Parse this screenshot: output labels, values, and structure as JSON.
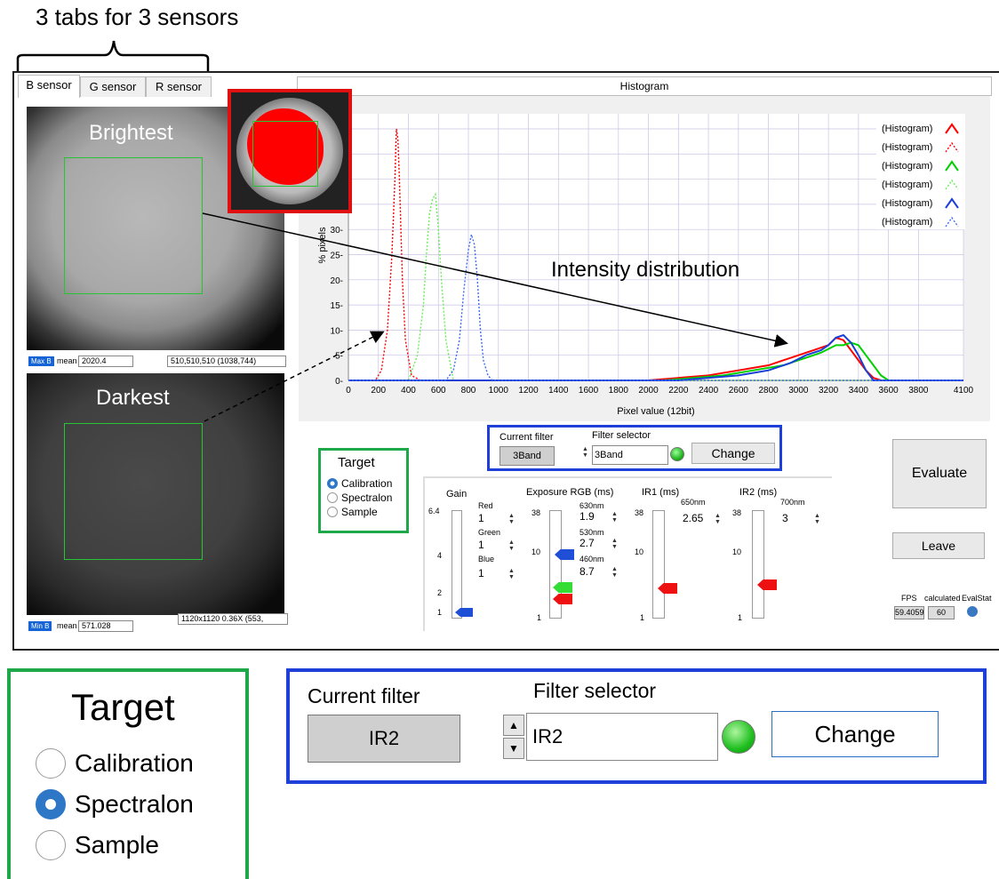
{
  "annotation": {
    "title": "3 tabs for 3 sensors",
    "intensity_label": "Intensity distribution"
  },
  "tabs": [
    {
      "label": "B sensor",
      "active": true
    },
    {
      "label": "G sensor",
      "active": false
    },
    {
      "label": "R sensor",
      "active": false
    }
  ],
  "brightest": {
    "label": "Brightest",
    "badge": "Max B",
    "mean_label": "mean",
    "mean_value": "2020.4",
    "info": "510,510,510   (1038,744)"
  },
  "darkest": {
    "label": "Darkest",
    "badge": "Min B",
    "mean_label": "mean",
    "mean_value": "571.028",
    "info": "1120x1120 0.36X    (553,"
  },
  "histogram": {
    "title": "Histogram"
  },
  "chart_data": {
    "type": "line",
    "xlabel": "Pixel value (12bit)",
    "ylabel": "% pixels",
    "xlim": [
      0,
      4100
    ],
    "ylim": [
      0,
      30
    ],
    "xticks": [
      "0",
      "200",
      "400",
      "600",
      "800",
      "1000",
      "1200",
      "1400",
      "1600",
      "1800",
      "2000",
      "2200",
      "2400",
      "2600",
      "2800",
      "3000",
      "3200",
      "3400",
      "3600",
      "3800",
      "4100"
    ],
    "yticks": [
      "0",
      "5",
      "10",
      "15",
      "20",
      "25",
      "30"
    ],
    "grid": true,
    "legend": "top-right",
    "series": [
      {
        "name": "(Histogram)",
        "color": "#ff0000",
        "style": "solid",
        "x": [
          0,
          2000,
          2400,
          2600,
          2800,
          2900,
          3000,
          3100,
          3150,
          3200,
          3250,
          3300,
          3350,
          3400,
          3450,
          3500,
          3550,
          4100
        ],
        "y": [
          0,
          0,
          1,
          2,
          3,
          4,
          5,
          6,
          6.5,
          7,
          8.5,
          8,
          6,
          4,
          2,
          0.5,
          0,
          0
        ]
      },
      {
        "name": "(Histogram)",
        "color": "#ff0000",
        "style": "dotted",
        "x": [
          0,
          180,
          220,
          260,
          290,
          310,
          320,
          330,
          340,
          350,
          360,
          380,
          420,
          480,
          4100
        ],
        "y": [
          0,
          0,
          2,
          10,
          25,
          40,
          50,
          48,
          40,
          30,
          20,
          8,
          1,
          0,
          0
        ]
      },
      {
        "name": "(Histogram)",
        "color": "#00d000",
        "style": "solid",
        "x": [
          0,
          2100,
          2500,
          2700,
          2900,
          3050,
          3150,
          3250,
          3300,
          3350,
          3400,
          3450,
          3500,
          3550,
          3600,
          4100
        ],
        "y": [
          0,
          0,
          1,
          2,
          3,
          4.5,
          5.5,
          7,
          7,
          7.5,
          7,
          5,
          3,
          1,
          0,
          0
        ]
      },
      {
        "name": "(Histogram)",
        "color": "#66ee55",
        "style": "dotted",
        "x": [
          0,
          400,
          460,
          500,
          520,
          540,
          560,
          580,
          600,
          620,
          650,
          700,
          4100
        ],
        "y": [
          0,
          0,
          5,
          15,
          25,
          33,
          36,
          37,
          30,
          20,
          8,
          0,
          0
        ]
      },
      {
        "name": "(Histogram)",
        "color": "#1a3fd6",
        "style": "solid",
        "x": [
          0,
          2200,
          2600,
          2800,
          2950,
          3050,
          3150,
          3200,
          3250,
          3300,
          3350,
          3400,
          3450,
          3500,
          4100
        ],
        "y": [
          0,
          0,
          1,
          2,
          3.5,
          5,
          6,
          7,
          8.5,
          9,
          7.5,
          5,
          2,
          0,
          0
        ]
      },
      {
        "name": "(Histogram)",
        "color": "#3b6df0",
        "style": "dotted",
        "x": [
          0,
          650,
          700,
          740,
          770,
          800,
          820,
          840,
          860,
          880,
          900,
          930,
          960,
          4100
        ],
        "y": [
          0,
          0,
          2,
          8,
          18,
          26,
          29,
          27,
          20,
          10,
          4,
          1,
          0,
          0
        ]
      }
    ]
  },
  "target_panel": {
    "title": "Target",
    "options": [
      {
        "label": "Calibration",
        "selected": true
      },
      {
        "label": "Spectralon",
        "selected": false
      },
      {
        "label": "Sample",
        "selected": false
      }
    ]
  },
  "filter_panel": {
    "current_filter_label": "Current filter",
    "current_filter_value": "3Band",
    "selector_label": "Filter selector",
    "selector_value": "3Band",
    "change_button": "Change"
  },
  "evaluate_button": "Evaluate",
  "leave_button": "Leave",
  "gain": {
    "label": "Gain",
    "top_tick": "6.4",
    "ticks": [
      "4",
      "2",
      "1"
    ],
    "red_label": "Red",
    "red_value": "1",
    "green_label": "Green",
    "green_value": "1",
    "blue_label": "Blue",
    "blue_value": "1"
  },
  "exposure": {
    "label": "Exposure RGB (ms)",
    "top_tick": "38",
    "mid_tick": "10",
    "low_tick": "1",
    "nm630": "630nm",
    "v630": "1.9",
    "nm530": "530nm",
    "v530": "2.7",
    "nm460": "460nm",
    "v460": "8.7"
  },
  "ir1": {
    "label": "IR1 (ms)",
    "nm": "650nm",
    "value": "2.65",
    "top_tick": "38",
    "mid_tick": "10",
    "low_tick": "1"
  },
  "ir2": {
    "label": "IR2 (ms)",
    "nm": "700nm",
    "value": "3",
    "top_tick": "38",
    "mid_tick": "10",
    "low_tick": "1"
  },
  "stats": {
    "fps_label": "FPS",
    "fps_value": "59.4059",
    "calc_label": "calculated",
    "calc_value": "60",
    "evalstat_label": "EvalStat"
  },
  "zoom_target": {
    "title": "Target",
    "options": [
      {
        "label": "Calibration",
        "selected": false
      },
      {
        "label": "Spectralon",
        "selected": true
      },
      {
        "label": "Sample",
        "selected": false
      }
    ]
  },
  "zoom_filter": {
    "current_filter_label": "Current filter",
    "current_filter_value": "IR2",
    "selector_label": "Filter selector",
    "selector_value": "IR2",
    "change_button": "Change"
  }
}
